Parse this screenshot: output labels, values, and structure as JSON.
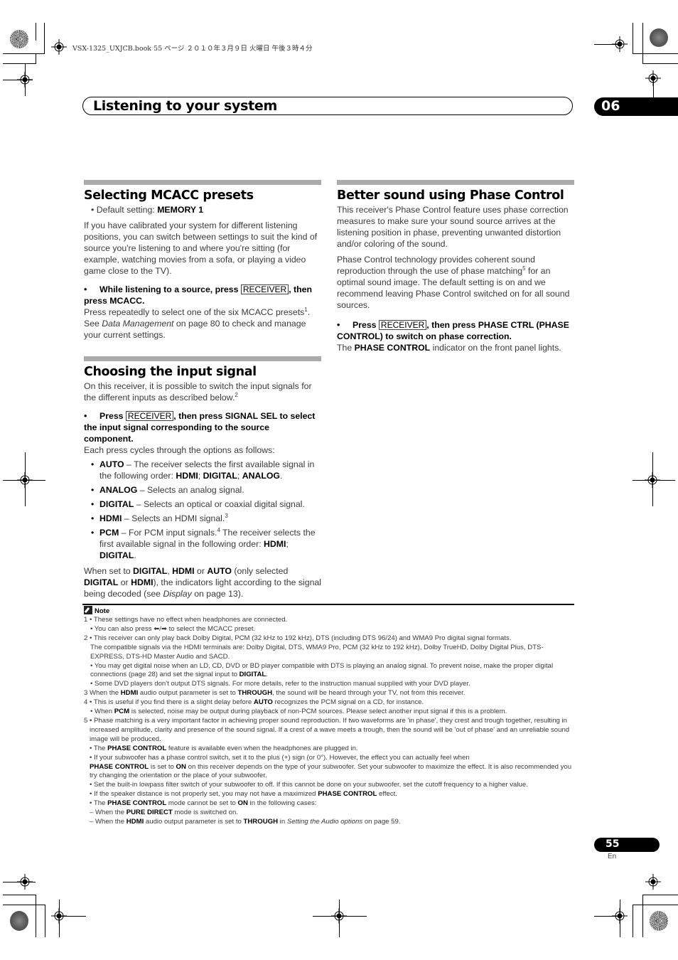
{
  "slug": "VSX-1325_UXJCB.book  55 ページ  ２０１０年３月９日  火曜日  午後３時４分",
  "header": {
    "title": "Listening to your system",
    "chapter": "06"
  },
  "sections": {
    "mcacc": {
      "title": "Selecting MCACC presets",
      "default_prefix": "Default setting: ",
      "default_value": "MEMORY 1",
      "para1": "If you have calibrated your system for different listening positions, you can switch between settings to suit the kind of source you're listening to and where you're sitting (for example, watching movies from a sofa, or playing a video game close to the TV).",
      "step_a": "While listening to a source, press ",
      "key": "RECEIVER",
      "step_b": ", then press MCACC.",
      "para2_a": "Press repeatedly to select one of the six MCACC presets",
      "para2_sup": "1",
      "para2_b": ". See ",
      "para2_ref": "Data Management",
      "para2_c": " on page 80 to check and manage your current settings."
    },
    "input": {
      "title": "Choosing the input signal",
      "para1": "On this receiver, it is possible to switch the input signals for the different inputs as described below.",
      "para1_sup": "2",
      "step_a": "Press ",
      "key": "RECEIVER",
      "step_b": ", then press SIGNAL SEL to select the input signal corresponding to the source component.",
      "cycle": "Each press cycles through the options as follows:",
      "options": [
        {
          "name": "AUTO",
          "desc": " – The receiver selects the first available signal in the following order: ",
          "order": [
            "HDMI",
            "DIGITAL",
            "ANALOG"
          ]
        },
        {
          "name": "ANALOG",
          "desc": " – Selects an analog signal."
        },
        {
          "name": "DIGITAL",
          "desc": " – Selects an optical or coaxial digital signal."
        },
        {
          "name": "HDMI",
          "desc": " – Selects an HDMI signal.",
          "sup": "3"
        },
        {
          "name": "PCM",
          "desc": " – For PCM input signals.",
          "sup": "4",
          "desc2": " The receiver selects the first available signal in the following order: ",
          "order": [
            "HDMI",
            "DIGITAL"
          ]
        }
      ],
      "closing": {
        "t1": "When set to ",
        "b1": "DIGITAL",
        "t2": ", ",
        "b2": "HDMI",
        "t3": " or ",
        "b3": "AUTO",
        "t4": " (only selected ",
        "b4": "DIGITAL",
        "t5": " or ",
        "b5": "HDMI",
        "t6": "), the indicators light according to the signal being decoded (see ",
        "ref": "Display",
        "t7": " on page 13)."
      }
    },
    "phase": {
      "title": "Better sound using Phase Control",
      "para1": "This receiver's Phase Control feature uses phase correction measures to make sure your sound source arrives at the listening position in phase, preventing unwanted distortion and/or coloring of the sound.",
      "para2_a": "Phase Control technology provides coherent sound reproduction through the use of phase matching",
      "para2_sup": "5",
      "para2_b": " for an optimal sound image. The default setting is on and we recommend leaving Phase Control switched on for all sound sources.",
      "step_a": "Press ",
      "key": "RECEIVER",
      "step_b": ", then press PHASE CTRL (PHASE CONTROL) to switch on phase correction.",
      "result_a": "The ",
      "result_b": "PHASE CONTROL",
      "result_c": " indicator on the front panel lights."
    }
  },
  "notes": {
    "heading": "Note",
    "lines": [
      "1 • These settings have no effect when headphones are connected.",
      "• You can also press ⬅/➡ to select the MCACC preset.",
      "2 • This receiver can only play back Dolby Digital, PCM (32 kHz to 192 kHz), DTS (including DTS 96/24) and WMA9 Pro digital signal formats.",
      "The compatible signals via the HDMI terminals are: Dolby Digital, DTS, WMA9 Pro, PCM (32 kHz to 192 kHz), Dolby TrueHD, Dolby Digital Plus, DTS-EXPRESS, DTS-HD Master Audio and SACD.",
      "• You may get digital noise when an LD, CD, DVD or BD player compatible with DTS is playing an analog signal. To prevent noise, make the proper digital connections (page 28) and set the signal input to ",
      "DIGITAL",
      "• Some DVD players don't output DTS signals. For more details, refer to the instruction manual supplied with your DVD player.",
      "3 When the ",
      "HDMI",
      " audio output parameter is set to ",
      "THROUGH",
      ", the sound will be heard through your TV, not from this receiver.",
      "4 • This is useful if you find there is a slight delay before ",
      "AUTO",
      " recognizes the PCM signal on a CD, for instance.",
      "• When ",
      "PCM",
      " is selected, noise may be output during playback of non-PCM sources. Please select another input signal if this is a problem.",
      "5 • Phase matching is a very important factor in achieving proper sound reproduction. If two waveforms are 'in phase', they crest and trough together, resulting in increased amplitude, clarity and presence of the sound signal. If a crest of a wave meets a trough, then the sound will be 'out of phase' and an unreliable sound image will be produced.",
      "• The ",
      "PHASE CONTROL",
      " feature is available even when the headphones are plugged in.",
      "• If your subwoofer has a phase control switch, set it to the plus (+) sign (or 0°). However, the effect you can actually feel when ",
      "PHASE CONTROL",
      " is set to ",
      "ON",
      " on this receiver depends on the type of your subwoofer. Set your subwoofer to maximize the effect. It is also recommended you try changing the orientation or the place of your subwoofer.",
      "• Set the built-in lowpass filter switch of your subwoofer to off. If this cannot be done on your subwoofer, set the cutoff frequency to a higher value.",
      "• If the speaker distance is not properly set, you may not have a maximized ",
      "PHASE CONTROL",
      " effect.",
      "• The ",
      "PHASE CONTROL",
      " mode cannot be set to ",
      "ON",
      " in the following cases:",
      "– When the ",
      "PURE DIRECT",
      " mode is switched on.",
      "– When the ",
      "HDMI",
      " audio output parameter is set to ",
      "THROUGH",
      " in ",
      "Setting the Audio options",
      " on page 59."
    ]
  },
  "footer": {
    "page": "55",
    "lang": "En"
  }
}
